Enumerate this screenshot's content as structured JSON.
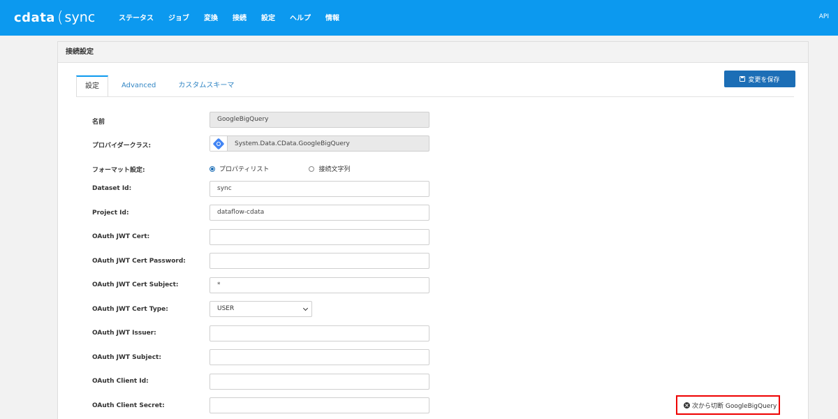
{
  "topbar": {
    "logo_cdata": "cdata",
    "logo_sync": "sync",
    "nav": [
      "ステータス",
      "ジョブ",
      "変換",
      "接続",
      "設定",
      "ヘルプ",
      "情報"
    ],
    "api_label": "API"
  },
  "panel": {
    "title": "接続設定",
    "tabs": [
      "設定",
      "Advanced",
      "カスタムスキーマ"
    ],
    "active_tab": "設定",
    "save_label": "変更を保存"
  },
  "form": {
    "name_label": "名前",
    "name_value": "GoogleBigQuery",
    "provider_label": "プロバイダークラス:",
    "provider_value": "System.Data.CData.GoogleBigQuery",
    "format_label": "フォーマット設定:",
    "format_options": [
      "プロパティリスト",
      "接続文字列"
    ],
    "format_selected": "プロパティリスト",
    "dataset_label": "Dataset Id:",
    "dataset_value": "sync",
    "project_label": "Project Id:",
    "project_value": "dataflow-cdata",
    "jwt_cert_label": "OAuth JWT Cert:",
    "jwt_cert_value": "",
    "jwt_cert_password_label": "OAuth JWT Cert Password:",
    "jwt_cert_password_value": "",
    "jwt_cert_subject_label": "OAuth JWT Cert Subject:",
    "jwt_cert_subject_value": "*",
    "jwt_cert_type_label": "OAuth JWT Cert Type:",
    "jwt_cert_type_value": "USER",
    "jwt_issuer_label": "OAuth JWT Issuer:",
    "jwt_issuer_value": "",
    "jwt_subject_label": "OAuth JWT Subject:",
    "jwt_subject_value": "",
    "client_id_label": "OAuth Client Id:",
    "client_id_value": "",
    "client_secret_label": "OAuth Client Secret:",
    "client_secret_value": ""
  },
  "disconnect": {
    "label": "次から切断 GoogleBigQuery"
  },
  "colors": {
    "topbar": "#0c99ef",
    "save_button": "#1c6eb6",
    "highlight_border": "#ee0000"
  },
  "icons": {
    "provider": "google-bigquery-icon",
    "save": "save-disk-icon",
    "disconnect": "disconnect-circle-icon"
  }
}
